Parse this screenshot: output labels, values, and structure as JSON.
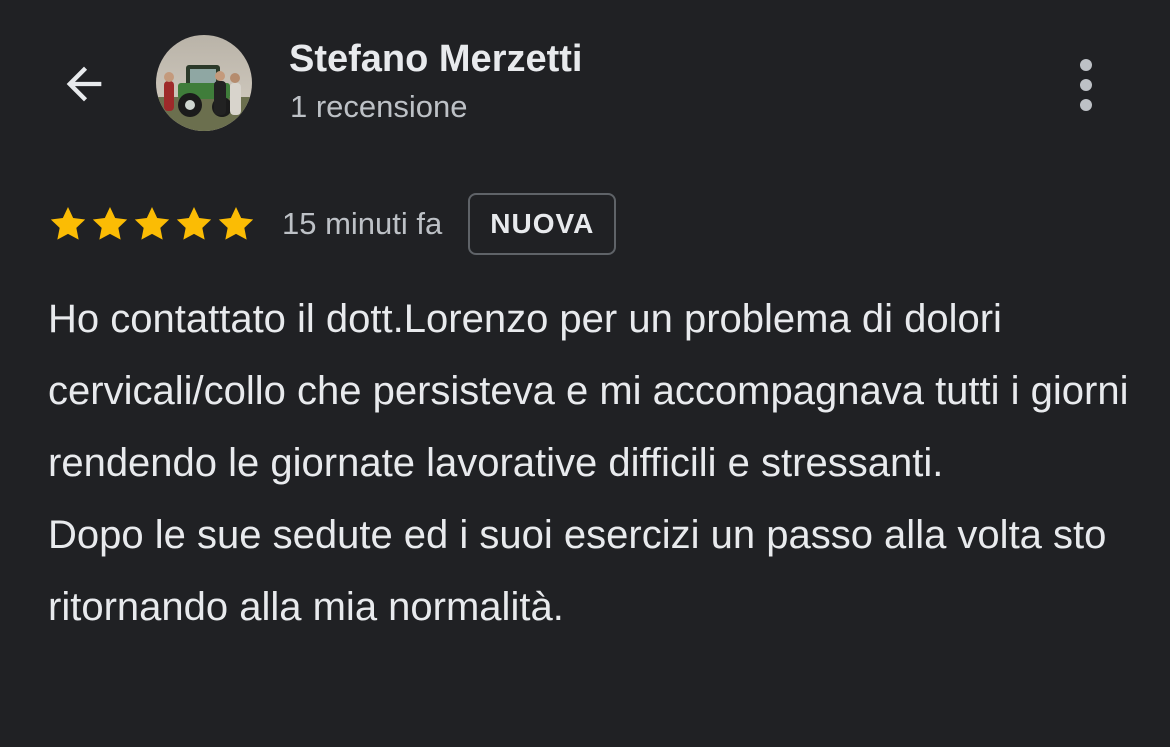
{
  "header": {
    "back_icon": "arrow-back-icon",
    "avatar_icon": "profile-photo",
    "name": "Stefano Merzetti",
    "subtitle": "1 recensione",
    "more_icon": "more-vertical-icon"
  },
  "review": {
    "rating": 5,
    "rating_max": 5,
    "star_color": "#fbbc04",
    "time": "15 minuti fa",
    "badge": "NUOVA",
    "paragraphs": [
      "Ho contattato il dott.Lorenzo per un problema di dolori cervicali/collo che persisteva e mi accompagnava tutti i giorni rendendo le giornate lavorative difficili e stressanti.",
      "Dopo le sue sedute ed i suoi esercizi un passo alla volta sto ritornando alla mia normalità."
    ]
  }
}
